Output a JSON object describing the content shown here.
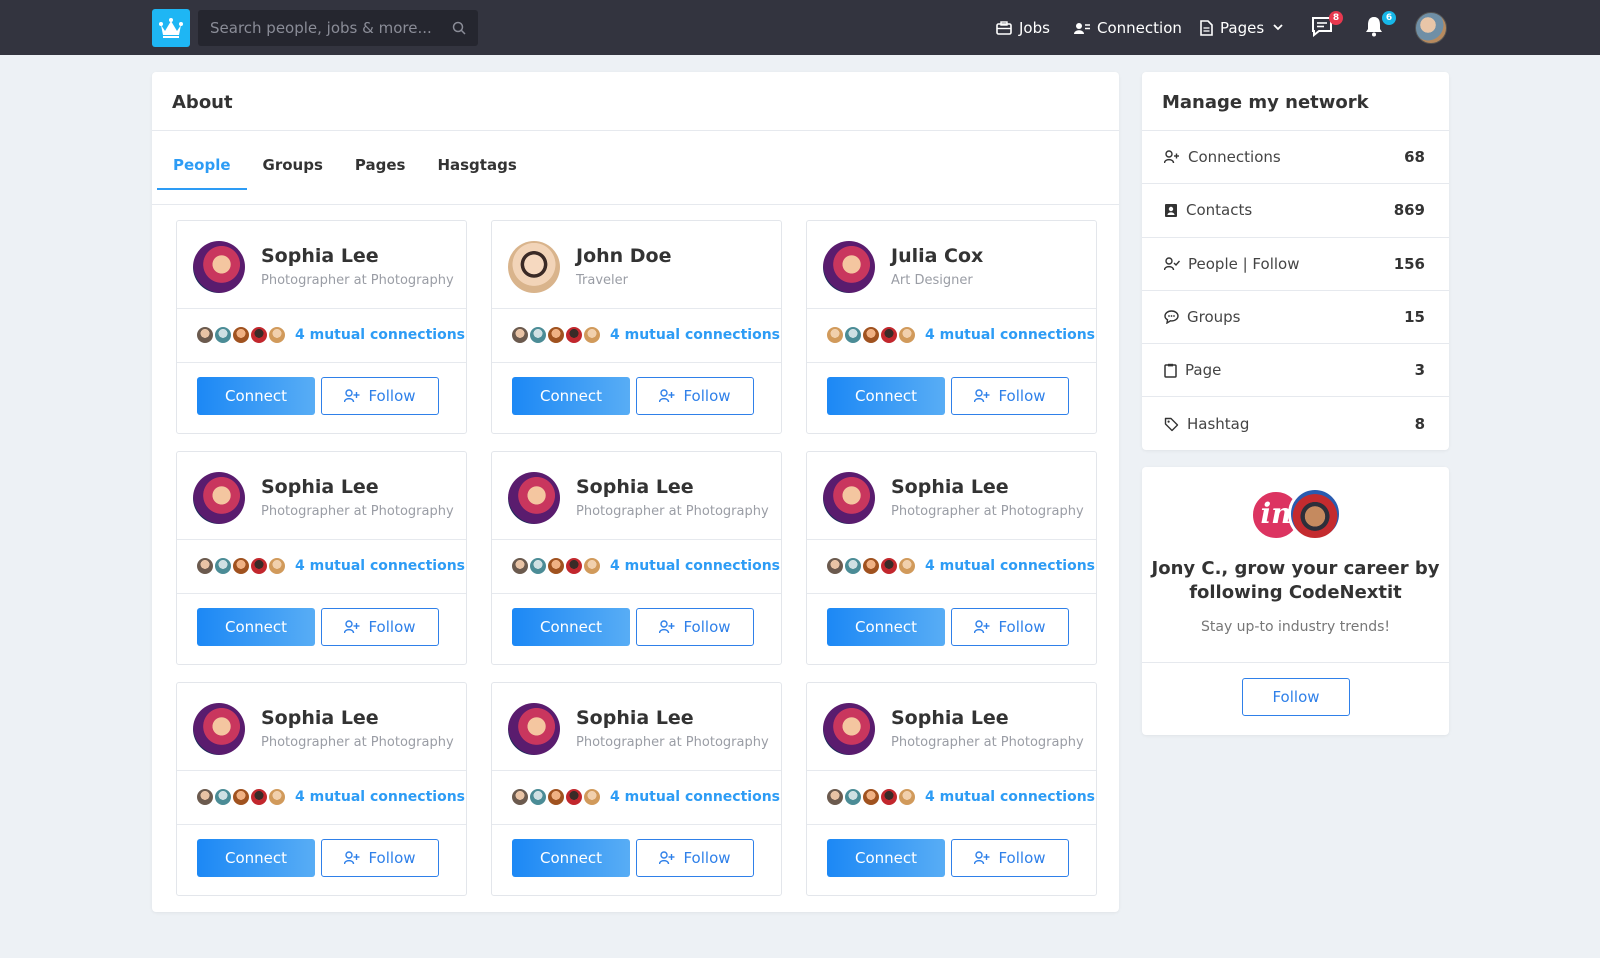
{
  "header": {
    "search_placeholder": "Search people, jobs & more...",
    "nav": {
      "jobs": "Jobs",
      "connection": "Connection",
      "pages": "Pages"
    },
    "messages_badge": "8",
    "notifications_badge": "6"
  },
  "about": {
    "title": "About",
    "tabs": [
      "People",
      "Groups",
      "Pages",
      "Hasgtags"
    ],
    "active_tab": "People",
    "people": [
      {
        "name": "Sophia Lee",
        "role": "Photographer at Photography",
        "mutual": "4 mutual connections",
        "connect": "Connect",
        "follow": "Follow"
      },
      {
        "name": "John Doe",
        "role": "Traveler",
        "mutual": "4 mutual connections",
        "connect": "Connect",
        "follow": "Follow"
      },
      {
        "name": "Julia Cox",
        "role": "Art Designer",
        "mutual": "4 mutual connections",
        "connect": "Connect",
        "follow": "Follow"
      },
      {
        "name": "Sophia Lee",
        "role": "Photographer at Photography",
        "mutual": "4 mutual connections",
        "connect": "Connect",
        "follow": "Follow"
      },
      {
        "name": "Sophia Lee",
        "role": "Photographer at Photography",
        "mutual": "4 mutual connections",
        "connect": "Connect",
        "follow": "Follow"
      },
      {
        "name": "Sophia Lee",
        "role": "Photographer at Photography",
        "mutual": "4 mutual connections",
        "connect": "Connect",
        "follow": "Follow"
      },
      {
        "name": "Sophia Lee",
        "role": "Photographer at Photography",
        "mutual": "4 mutual connections",
        "connect": "Connect",
        "follow": "Follow"
      },
      {
        "name": "Sophia Lee",
        "role": "Photographer at Photography",
        "mutual": "4 mutual connections",
        "connect": "Connect",
        "follow": "Follow"
      },
      {
        "name": "Sophia Lee",
        "role": "Photographer at Photography",
        "mutual": "4 mutual connections",
        "connect": "Connect",
        "follow": "Follow"
      }
    ]
  },
  "network": {
    "title": "Manage my network",
    "items": [
      {
        "label": "Connections",
        "count": "68",
        "icon": "user-plus-icon"
      },
      {
        "label": "Contacts",
        "count": "869",
        "icon": "contact-book-icon"
      },
      {
        "label": "People | Follow",
        "count": "156",
        "icon": "user-check-icon"
      },
      {
        "label": "Groups",
        "count": "15",
        "icon": "chat-bubble-icon"
      },
      {
        "label": "Page",
        "count": "3",
        "icon": "clipboard-icon"
      },
      {
        "label": "Hashtag",
        "count": "8",
        "icon": "tag-icon"
      }
    ]
  },
  "promo": {
    "logo_text": "in",
    "headline": "Jony C., grow your career by following CodeNextit",
    "subtext": "Stay up-to industry trends!",
    "button": "Follow"
  },
  "colors": {
    "accent": "#2d9cf5",
    "topbar": "#33343f",
    "logo": "#1eb6f4",
    "badge_red": "#e8384f",
    "badge_cyan": "#17b7e8"
  }
}
